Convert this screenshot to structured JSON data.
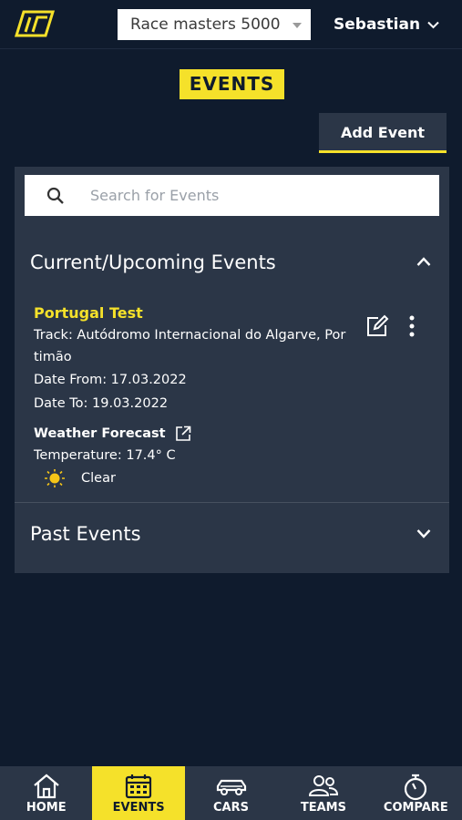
{
  "header": {
    "team_select_value": "Race masters 5000",
    "user_name": "Sebastian"
  },
  "page": {
    "title": "EVENTS",
    "add_event_label": "Add Event"
  },
  "search": {
    "placeholder": "Search for Events"
  },
  "sections": {
    "current": {
      "title": "Current/Upcoming Events",
      "expanded": true
    },
    "past": {
      "title": "Past Events",
      "expanded": false
    }
  },
  "event": {
    "name": "Portugal Test",
    "track_line1": "Track: Autódromo Internacional do Algarve, Por",
    "track_line2": "timão",
    "date_from": "Date From: 17.03.2022",
    "date_to": "Date To: 19.03.2022",
    "weather_title": "Weather Forecast",
    "temperature": "Temperature: 17.4° C",
    "condition": "Clear"
  },
  "nav": {
    "items": [
      {
        "label": "HOME",
        "icon": "home-icon"
      },
      {
        "label": "EVENTS",
        "icon": "calendar-icon",
        "active": true
      },
      {
        "label": "CARS",
        "icon": "car-icon"
      },
      {
        "label": "TEAMS",
        "icon": "team-icon"
      },
      {
        "label": "COMPARE",
        "icon": "stopwatch-icon"
      }
    ]
  },
  "colors": {
    "background": "#0f1b2d",
    "panel": "#2b3647",
    "accent": "#f5e12a"
  }
}
